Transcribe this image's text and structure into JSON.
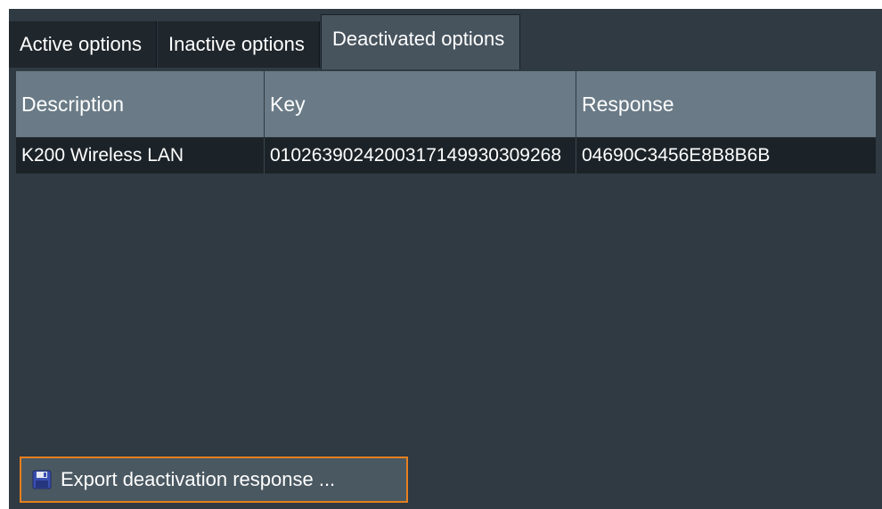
{
  "tabs": [
    {
      "label": "Active options"
    },
    {
      "label": "Inactive options"
    },
    {
      "label": "Deactivated options"
    }
  ],
  "table": {
    "headers": [
      "Description",
      "Key",
      "Response"
    ],
    "rows": [
      {
        "description": "K200 Wireless LAN",
        "key": "0102639024200317149930309268",
        "response": "04690C3456E8B8B6B"
      }
    ]
  },
  "export_button": {
    "label": "Export deactivation response ...",
    "icon": "save-icon"
  },
  "colors": {
    "panel_bg": "#2f3a43",
    "active_tab_bg": "#47545e",
    "header_bg": "#6a7b87",
    "row_bg": "#1c2328",
    "focus_border": "#e8801f"
  }
}
